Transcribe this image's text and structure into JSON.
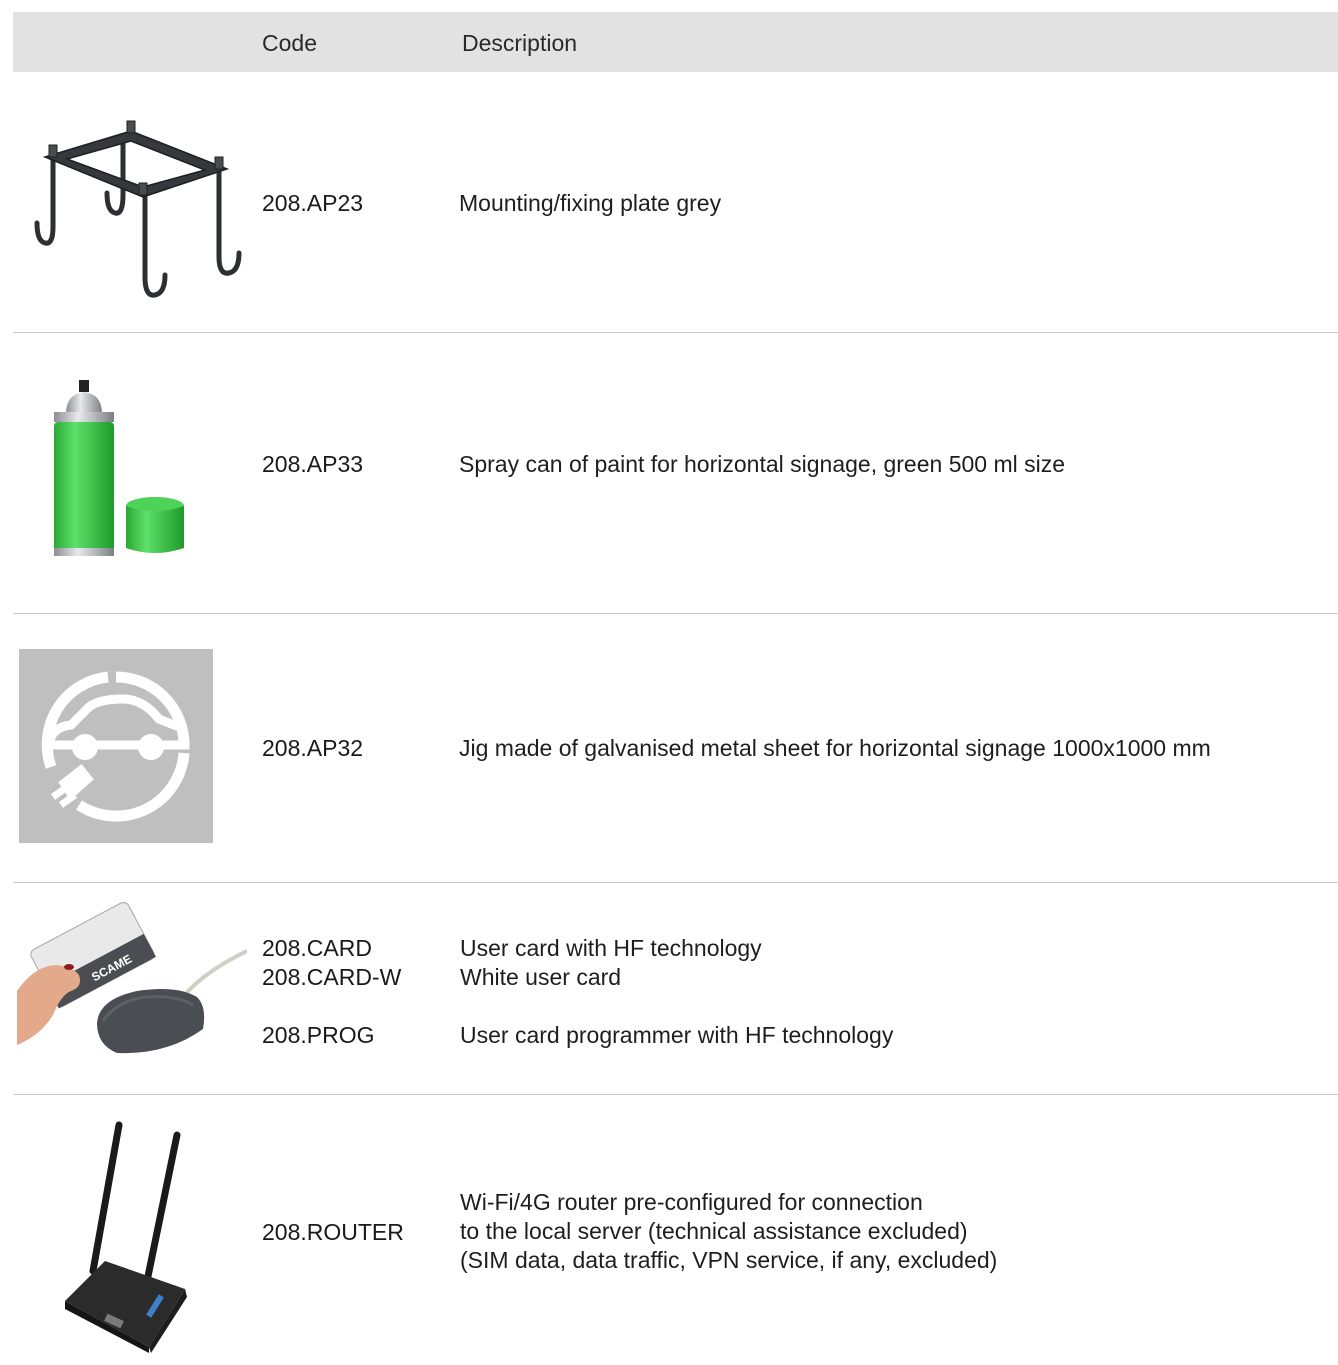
{
  "header": {
    "code_label": "Code",
    "description_label": "Description"
  },
  "rows": [
    {
      "code": "208.AP23",
      "description": "Mounting/fixing plate grey",
      "image_icon": "mounting-plate-image"
    },
    {
      "code": "208.AP33",
      "description": "Spray can of paint for horizontal signage, green 500 ml size",
      "image_icon": "spray-can-image"
    },
    {
      "code": "208.AP32",
      "description": "Jig made of galvanised metal sheet for horizontal signage 1000x1000 mm",
      "image_icon": "ev-signage-jig-image"
    },
    {
      "codes": [
        "208.CARD",
        "208.CARD-W",
        "208.PROG"
      ],
      "descriptions": [
        "User card with HF technology",
        "White user card",
        "User card programmer with HF technology"
      ],
      "image_icon": "user-card-reader-image",
      "card_brand": "SCAME"
    },
    {
      "code": "208.ROUTER",
      "descriptions": [
        "Wi-Fi/4G router pre-configured for connection",
        "to the local server (technical assistance excluded)",
        "(SIM data, data traffic, VPN service, if any, excluded)"
      ],
      "image_icon": "router-image"
    }
  ],
  "colors": {
    "header_bg": "#e2e2e3",
    "divider": "#c8c8c8",
    "spray_green": "#3fcf4a",
    "jig_grey": "#bfbfc0"
  }
}
